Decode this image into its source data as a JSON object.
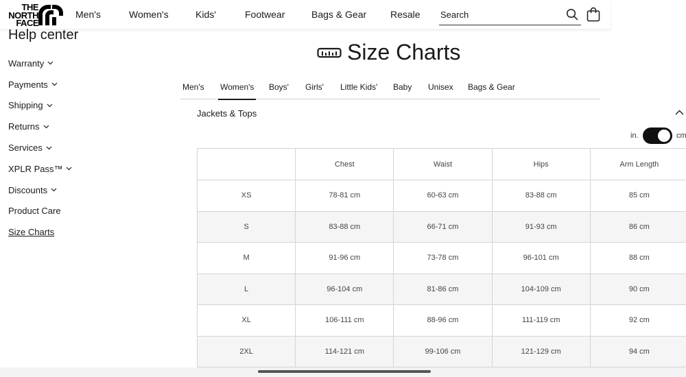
{
  "brand": {
    "logo_lines": [
      "THE",
      "NORTH",
      "FACE"
    ]
  },
  "nav": {
    "items": [
      "Men's",
      "Women's",
      "Kids'",
      "Footwear",
      "Bags & Gear",
      "Resale"
    ]
  },
  "search": {
    "placeholder": "Search"
  },
  "sidebar": {
    "title": "Help center",
    "items": [
      {
        "label": "Warranty",
        "has_chevron": true
      },
      {
        "label": "Payments",
        "has_chevron": true
      },
      {
        "label": "Shipping",
        "has_chevron": true
      },
      {
        "label": "Returns",
        "has_chevron": true
      },
      {
        "label": "Services",
        "has_chevron": true
      },
      {
        "label": "XPLR Pass™",
        "has_chevron": true
      },
      {
        "label": "Discounts",
        "has_chevron": true
      },
      {
        "label": "Product Care",
        "has_chevron": false
      },
      {
        "label": "Size Charts",
        "has_chevron": false,
        "active": true
      }
    ]
  },
  "page": {
    "title": "Size Charts",
    "icon": "ruler-icon"
  },
  "tabs": {
    "items": [
      "Men's",
      "Women's",
      "Boys'",
      "Girls'",
      "Little Kids'",
      "Baby",
      "Unisex",
      "Bags & Gear"
    ],
    "active": "Women's"
  },
  "accordion": {
    "label": "Jackets & Tops",
    "expanded": true
  },
  "units": {
    "left": "in.",
    "right": "cm",
    "selected": "cm"
  },
  "size_table": {
    "headers": [
      "",
      "Chest",
      "Waist",
      "Hips",
      "Arm Length"
    ],
    "rows": [
      [
        "XS",
        "78-81 cm",
        "60-63 cm",
        "83-88 cm",
        "85 cm"
      ],
      [
        "S",
        "83-88 cm",
        "66-71 cm",
        "91-93 cm",
        "86 cm"
      ],
      [
        "M",
        "91-96 cm",
        "73-78 cm",
        "96-101 cm",
        "88 cm"
      ],
      [
        "L",
        "96-104 cm",
        "81-86 cm",
        "104-109 cm",
        "90 cm"
      ],
      [
        "XL",
        "106-111 cm",
        "88-96 cm",
        "111-119 cm",
        "92 cm"
      ],
      [
        "2XL",
        "114-121 cm",
        "99-106 cm",
        "121-129 cm",
        "94 cm"
      ]
    ]
  },
  "colors": {
    "text": "#1a1a1a",
    "toggle": "#111111",
    "stripe": "#f5f5f5",
    "border": "#d4d4d4"
  }
}
